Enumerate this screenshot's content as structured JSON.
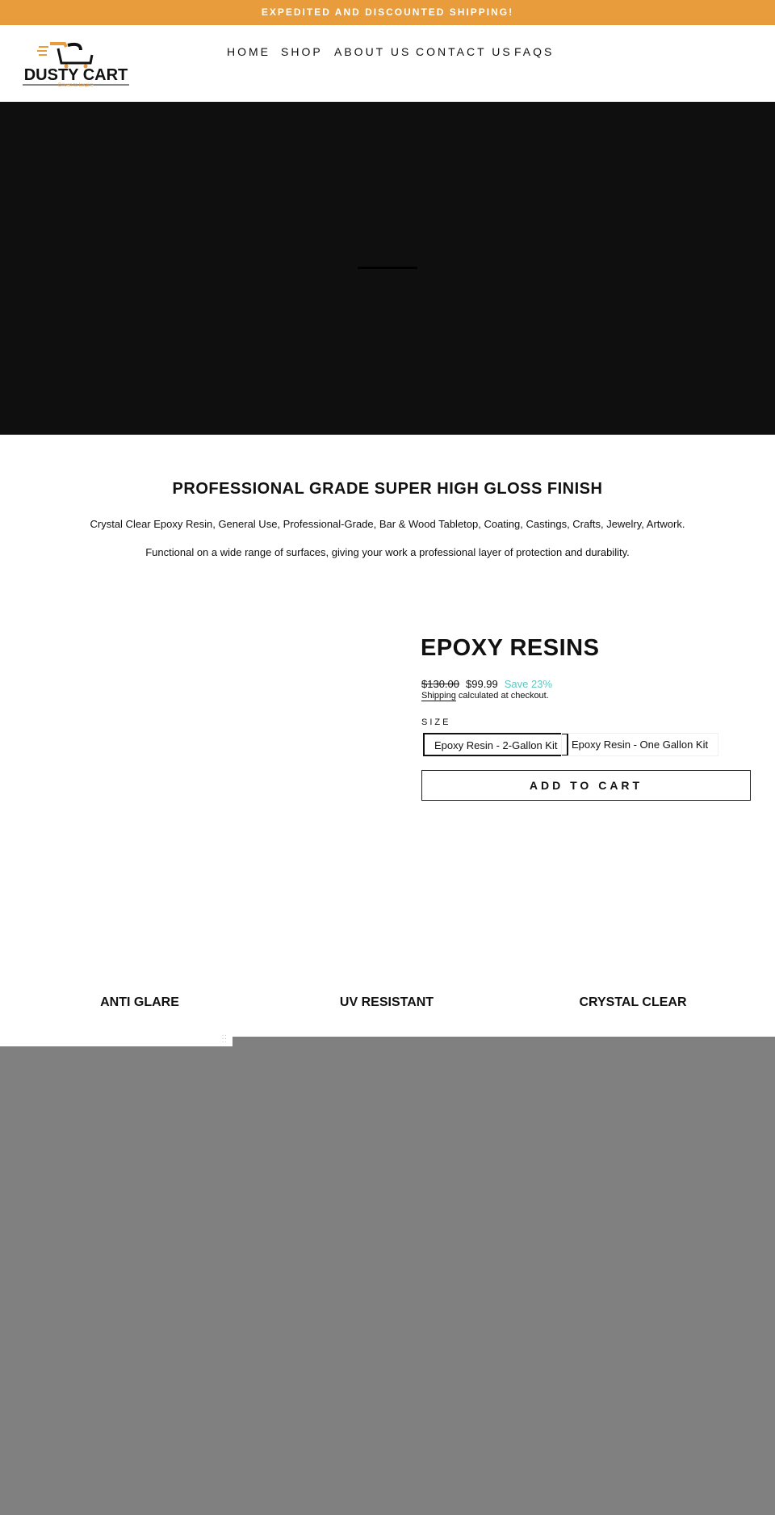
{
  "banner": {
    "text": "EXPEDITED AND DISCOUNTED SHIPPING!",
    "color": "#e89c3c"
  },
  "logo": {
    "name": "DUSTY CART",
    "tagline": "Driven to Inspire"
  },
  "nav": [
    "HOME",
    "SHOP",
    "ABOUT US",
    "CONTACT US",
    "FAQS"
  ],
  "intro": {
    "heading": "PROFESSIONAL GRADE SUPER HIGH GLOSS FINISH",
    "line1": "Crystal Clear Epoxy Resin, General Use, Professional-Grade, Bar & Wood Tabletop, Coating, Castings, Crafts, Jewelry, Artwork.",
    "line2": "Functional on a wide range of surfaces, giving your work a professional layer of protection and durability."
  },
  "product": {
    "title": "EPOXY RESINS",
    "compare_price": "$130.00",
    "price": "$99.99",
    "save": "Save 23%",
    "shipping_link": "Shipping",
    "shipping_text": " calculated at checkout.",
    "size_label": "SIZE",
    "options": [
      "Epoxy Resin - 2-Gallon Kit",
      "Epoxy Resin - One Gallon Kit"
    ],
    "selected": "Epoxy Resin - 2-Gallon Kit",
    "add_to_cart": "ADD TO CART",
    "save_color": "#5ec6c0"
  },
  "features": [
    "ANTI GLARE",
    "UV RESISTANT",
    "CRYSTAL CLEAR"
  ]
}
